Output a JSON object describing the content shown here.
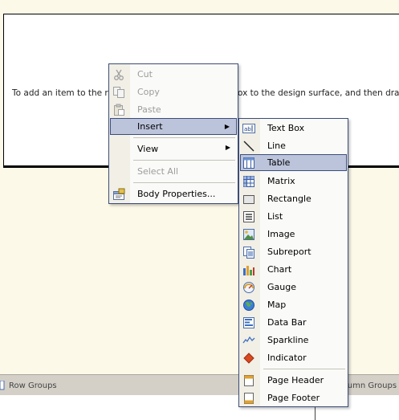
{
  "design": {
    "hint_left": "To add an item to the rep",
    "hint_right": "ox to the design surface, and then drag d"
  },
  "bottom": {
    "row_groups": "Row Groups",
    "column_groups": "lumn Groups"
  },
  "context_menu": {
    "cut": "Cut",
    "copy": "Copy",
    "paste": "Paste",
    "insert": "Insert",
    "view": "View",
    "select_all": "Select All",
    "body_properties": "Body Properties..."
  },
  "insert_menu": {
    "text_box": "Text Box",
    "line": "Line",
    "table": "Table",
    "matrix": "Matrix",
    "rectangle": "Rectangle",
    "list": "List",
    "image": "Image",
    "subreport": "Subreport",
    "chart": "Chart",
    "gauge": "Gauge",
    "map": "Map",
    "data_bar": "Data Bar",
    "sparkline": "Sparkline",
    "indicator": "Indicator",
    "page_header": "Page Header",
    "page_footer": "Page Footer"
  },
  "colors": {
    "highlight": "#bcc4dc",
    "menu_border": "#3c4d79",
    "background": "#fdf9e9"
  },
  "icons": {
    "cut": "scissors-icon",
    "copy": "copy-icon",
    "paste": "paste-icon",
    "body_properties": "properties-icon",
    "text_box": "textbox-icon",
    "line": "line-icon",
    "table": "table-icon",
    "matrix": "matrix-icon",
    "rectangle": "rectangle-icon",
    "list": "list-icon",
    "image": "image-icon",
    "subreport": "subreport-icon",
    "chart": "chart-icon",
    "gauge": "gauge-icon",
    "map": "map-icon",
    "data_bar": "databar-icon",
    "sparkline": "sparkline-icon",
    "indicator": "indicator-icon",
    "page_header": "page-header-icon",
    "page_footer": "page-footer-icon"
  }
}
